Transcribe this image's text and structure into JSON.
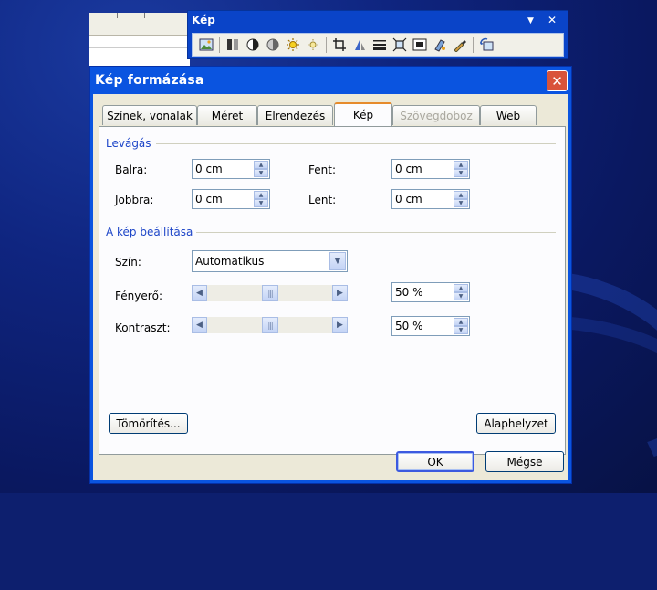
{
  "toolbar": {
    "title": "Kép",
    "dropdown_glyph": "▼",
    "close_glyph": "✕",
    "buttons": [
      "insert-picture",
      "color",
      "more-contrast",
      "less-contrast",
      "more-brightness",
      "less-brightness",
      "crop",
      "rotate-left",
      "line-style",
      "compress-pictures",
      "text-wrapping",
      "format-picture",
      "set-transparent-color",
      "reset-picture"
    ]
  },
  "dialog": {
    "title": "Kép formázása",
    "close_glyph": "✕",
    "tabs": [
      "Színek, vonalak",
      "Méret",
      "Elrendezés",
      "Kép",
      "Szövegdoboz",
      "Web"
    ],
    "active_tab": "Kép",
    "disabled_tab": "Szövegdoboz"
  },
  "crop": {
    "title": "Levágás",
    "left_label": "Balra:",
    "left_value": "0 cm",
    "top_label": "Fent:",
    "top_value": "0 cm",
    "right_label": "Jobbra:",
    "right_value": "0 cm",
    "bottom_label": "Lent:",
    "bottom_value": "0 cm"
  },
  "image_control": {
    "title": "A kép beállítása",
    "color_label": "Szín:",
    "color_value": "Automatikus",
    "brightness_label": "Fényerő:",
    "brightness_value": "50 %",
    "brightness_level": 0.5,
    "contrast_label": "Kontraszt:",
    "contrast_value": "50 %",
    "contrast_level": 0.5
  },
  "buttons": {
    "compress": "Tömörítés...",
    "reset": "Alaphelyzet",
    "ok": "OK",
    "cancel": "Mégse"
  },
  "colors": {
    "title_bar": "#0a54e0",
    "dialog_bg": "#ece9d8",
    "group_title": "#1e46c8",
    "active_tab_accent": "#e68b2c",
    "close_button": "#d9533a"
  }
}
